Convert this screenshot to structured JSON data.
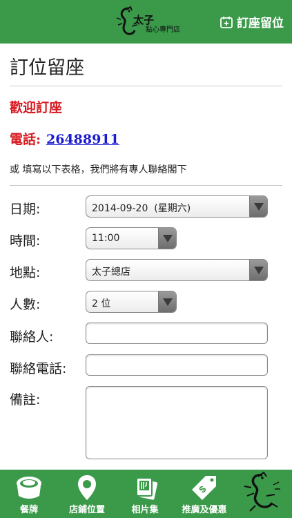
{
  "header": {
    "logo": {
      "text_primary": "太子",
      "text_secondary": "點心專門店"
    },
    "action_label": "訂座留位",
    "action_icon": "calendar-plus-icon"
  },
  "page": {
    "title": "訂位留座",
    "welcome": "歡迎訂座",
    "phone_label": "電話:",
    "phone_number": "26488911",
    "note": "或 填寫以下表格，我們將有專人聯絡閣下"
  },
  "form": {
    "date": {
      "label": "日期:",
      "value": "2014-09-20  (星期六)"
    },
    "time": {
      "label": "時間:",
      "value": "11:00"
    },
    "location": {
      "label": "地點:",
      "value": "太子總店"
    },
    "people": {
      "label": "人數:",
      "value": "2 位"
    },
    "contact": {
      "label": "聯絡人:",
      "value": ""
    },
    "phone": {
      "label": "聯絡電話:",
      "value": ""
    },
    "remarks": {
      "label": "備註:",
      "value": ""
    }
  },
  "tabs": [
    {
      "label": "餐牌",
      "icon": "dumpling-basket-icon"
    },
    {
      "label": "店鋪位置",
      "icon": "map-pin-icon"
    },
    {
      "label": "相片集",
      "icon": "photo-gallery-icon"
    },
    {
      "label": "推廣及優惠",
      "icon": "price-tag-icon"
    }
  ],
  "colors": {
    "brand_green": "#3a9a4a",
    "accent_red": "#d71920",
    "link_blue": "#1a1ad0"
  }
}
